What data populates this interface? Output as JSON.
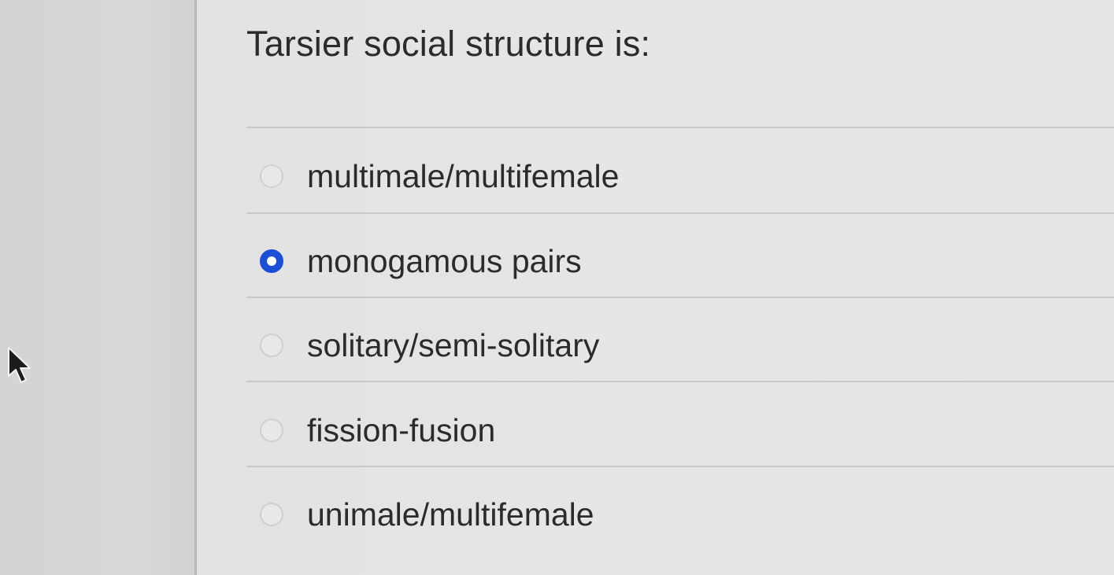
{
  "question": {
    "text": "Tarsier social structure is:"
  },
  "options": [
    {
      "label": "multimale/multifemale",
      "selected": false
    },
    {
      "label": "monogamous pairs",
      "selected": true
    },
    {
      "label": "solitary/semi-solitary",
      "selected": false
    },
    {
      "label": "fission-fusion",
      "selected": false
    },
    {
      "label": "unimale/multifemale",
      "selected": false
    }
  ],
  "colors": {
    "selected_radio": "#1a4fd6",
    "text": "#2b2b2b"
  },
  "icons": {
    "cursor": "mouse-pointer-icon"
  }
}
